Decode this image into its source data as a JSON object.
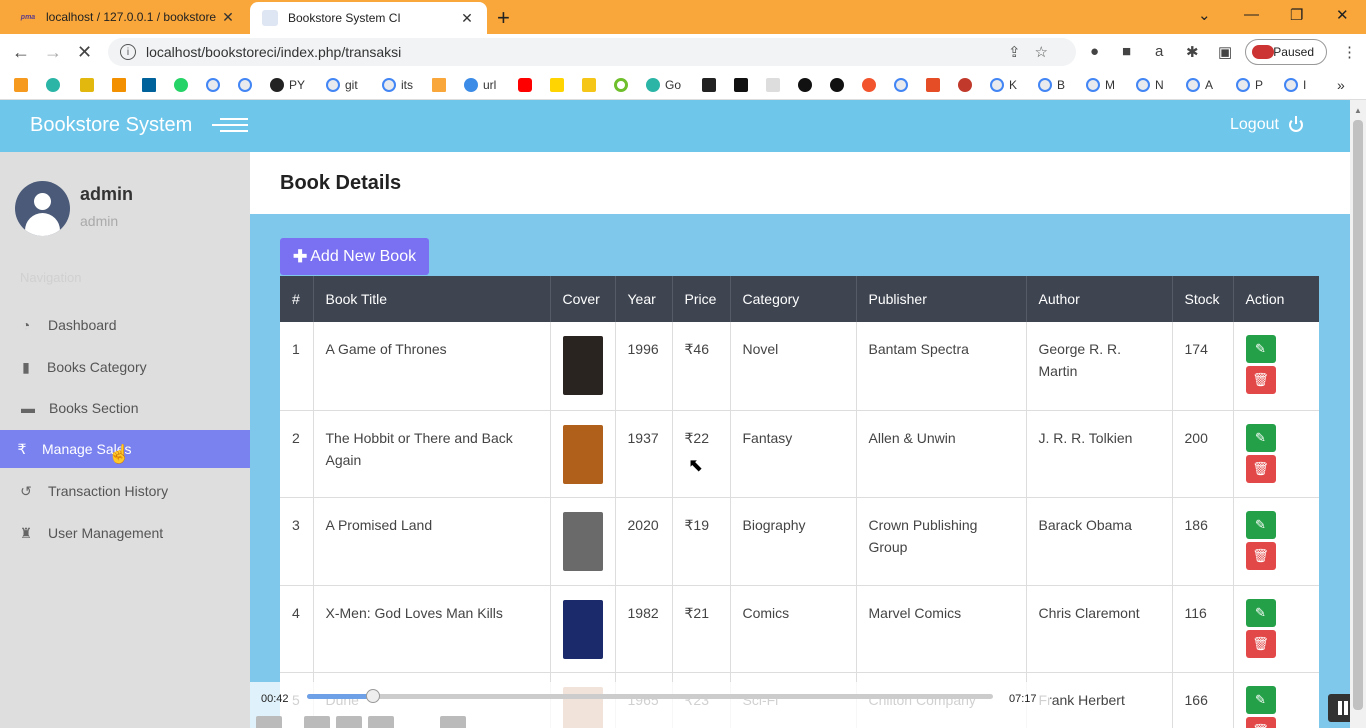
{
  "browser": {
    "tabs": [
      {
        "title": "localhost / 127.0.0.1 / bookstore",
        "favicon": "phpmyadmin-icon"
      },
      {
        "title": "Bookstore System CI",
        "favicon": "codeigniter-icon"
      }
    ],
    "url": "localhost/bookstoreci/index.php/transaksi",
    "profile_status": "Paused",
    "bookmarks": [
      "PY",
      "git",
      "its",
      "url",
      "Go",
      "K",
      "B",
      "M",
      "N",
      "A",
      "P",
      "I"
    ]
  },
  "app": {
    "brand": "Bookstore System",
    "logout_label": "Logout",
    "accent_color": "#6ec6ea",
    "active_color": "#7a82f0"
  },
  "user": {
    "name": "admin",
    "role": "admin"
  },
  "sidebar": {
    "header": "Navigation",
    "items": [
      {
        "label": "Dashboard",
        "icon": "dashboard-icon"
      },
      {
        "label": "Books Category",
        "icon": "bookmark-icon"
      },
      {
        "label": "Books Section",
        "icon": "book-icon"
      },
      {
        "label": "Manage Sales",
        "icon": "rupee-icon",
        "active": true
      },
      {
        "label": "Transaction History",
        "icon": "history-icon"
      },
      {
        "label": "User Management",
        "icon": "user-lock-icon"
      }
    ]
  },
  "page": {
    "title": "Book Details",
    "add_button": "Add New Book"
  },
  "table": {
    "headers": [
      "#",
      "Book Title",
      "Cover",
      "Year",
      "Price",
      "Category",
      "Publisher",
      "Author",
      "Stock",
      "Action"
    ],
    "rows": [
      {
        "num": "1",
        "title": "A Game of Thrones",
        "year": "1996",
        "price": "₹46",
        "category": "Novel",
        "publisher": "Bantam Spectra",
        "author": "George R. R. Martin",
        "stock": "174",
        "cover_color": "#2a2420"
      },
      {
        "num": "2",
        "title": "The Hobbit or There and Back Again",
        "year": "1937",
        "price": "₹22",
        "category": "Fantasy",
        "publisher": "Allen & Unwin",
        "author": "J. R. R. Tolkien",
        "stock": "200",
        "cover_color": "#b0601a"
      },
      {
        "num": "3",
        "title": "A Promised Land",
        "year": "2020",
        "price": "₹19",
        "category": "Biography",
        "publisher": "Crown Publishing Group",
        "author": "Barack Obama",
        "stock": "186",
        "cover_color": "#6a6a6a"
      },
      {
        "num": "4",
        "title": "X-Men: God Loves Man Kills",
        "year": "1982",
        "price": "₹21",
        "category": "Comics",
        "publisher": "Marvel Comics",
        "author": "Chris Claremont",
        "stock": "116",
        "cover_color": "#1a2a6a"
      },
      {
        "num": "5",
        "title": "Dune",
        "year": "1965",
        "price": "₹23",
        "category": "Sci-Fi",
        "publisher": "Chilton Company",
        "author": "Frank Herbert",
        "stock": "166",
        "cover_color": "#c8906a"
      }
    ]
  },
  "video": {
    "current_time": "00:42",
    "total_time": "07:17",
    "progress": 0.096
  }
}
